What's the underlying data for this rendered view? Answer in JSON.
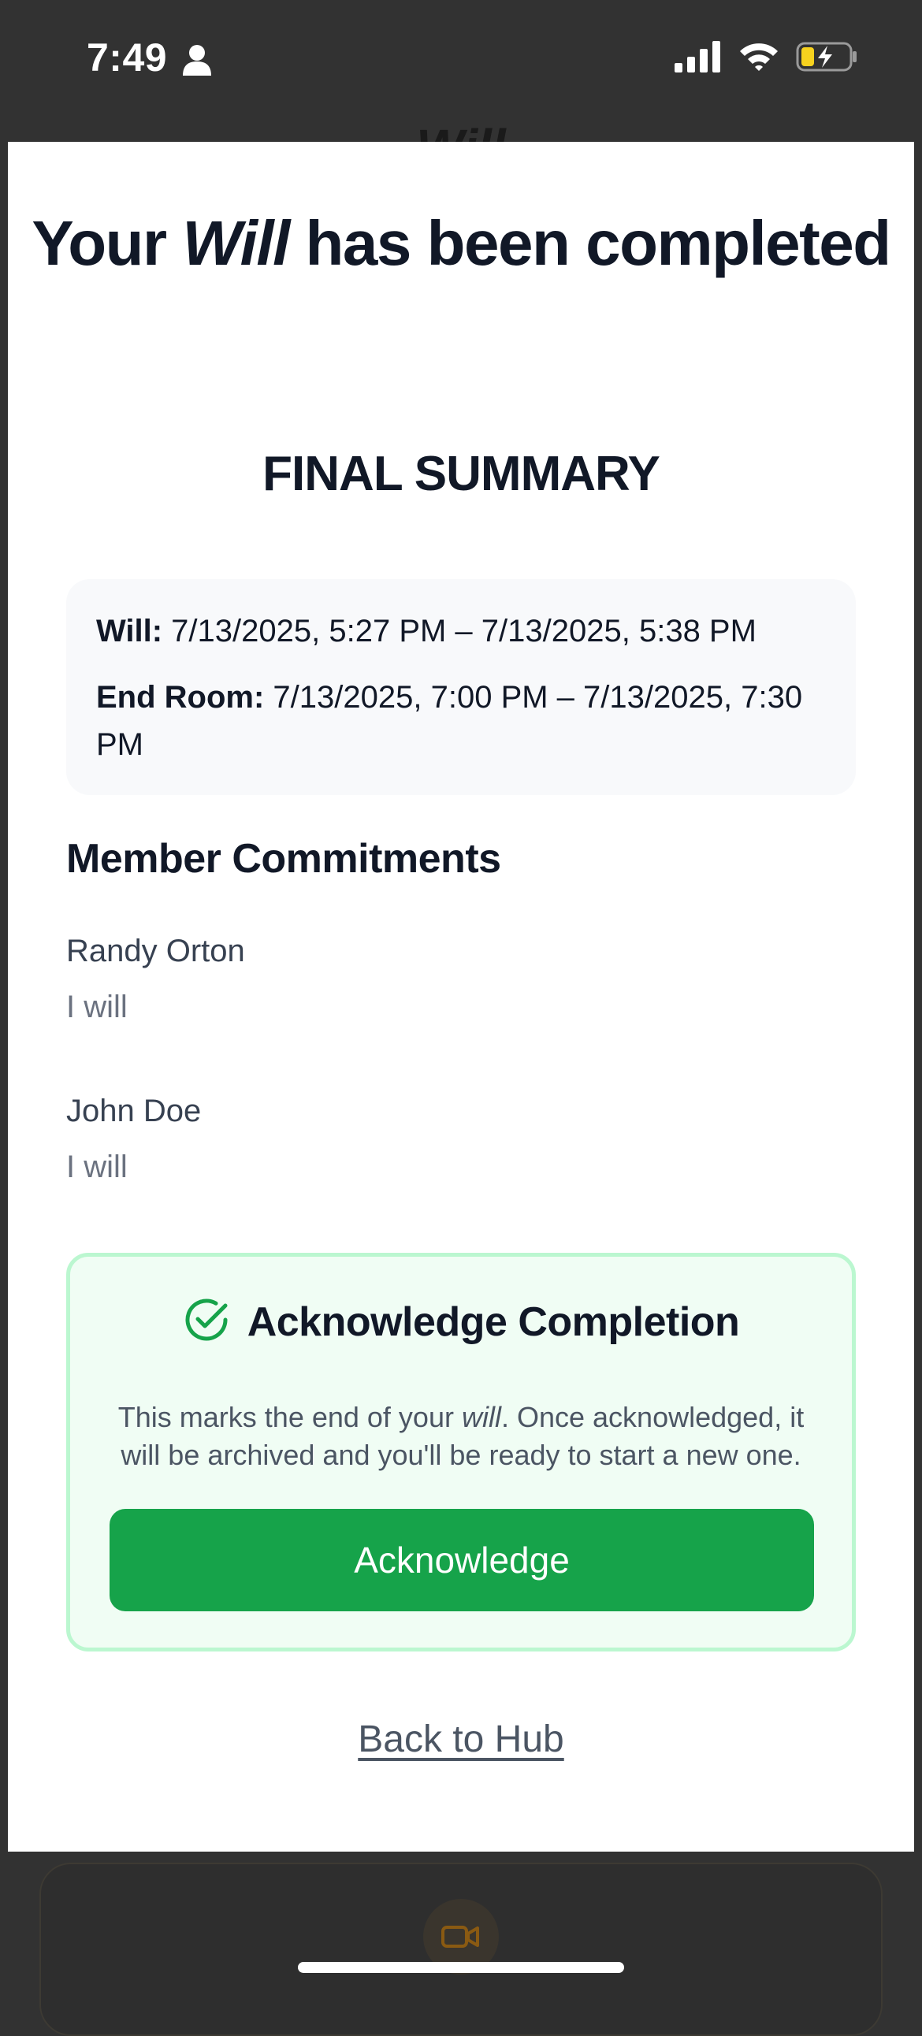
{
  "status_bar": {
    "time": "7:49",
    "icons": [
      "person-icon",
      "signal-icon",
      "wifi-icon",
      "battery-charging-icon"
    ]
  },
  "background": {
    "title_peek": "Will"
  },
  "headline": {
    "prefix": "Your ",
    "emphasis": "Will",
    "suffix": " has been completed"
  },
  "summary": {
    "title": "FINAL SUMMARY",
    "will_label": "Will:",
    "will_value": " 7/13/2025, 5:27 PM – 7/13/2025, 5:38 PM",
    "end_room_label": "End Room:",
    "end_room_value": " 7/13/2025, 7:00 PM – 7/13/2025, 7:30 PM"
  },
  "commitments": {
    "title": "Member Commitments",
    "members": [
      {
        "name": "Randy Orton",
        "text": "I will"
      },
      {
        "name": "John Doe",
        "text": "I will"
      }
    ]
  },
  "acknowledge": {
    "heading": "Acknowledge Completion",
    "desc_prefix": "This marks the end of your ",
    "desc_emphasis": "will",
    "desc_suffix": ". Once acknowledged, it will be archived and you'll be ready to start a new one.",
    "button_label": "Acknowledge",
    "accent": "#16a34a"
  },
  "back_link": "Back to Hub",
  "bottom_bar": {
    "icon": "video-camera-icon"
  }
}
